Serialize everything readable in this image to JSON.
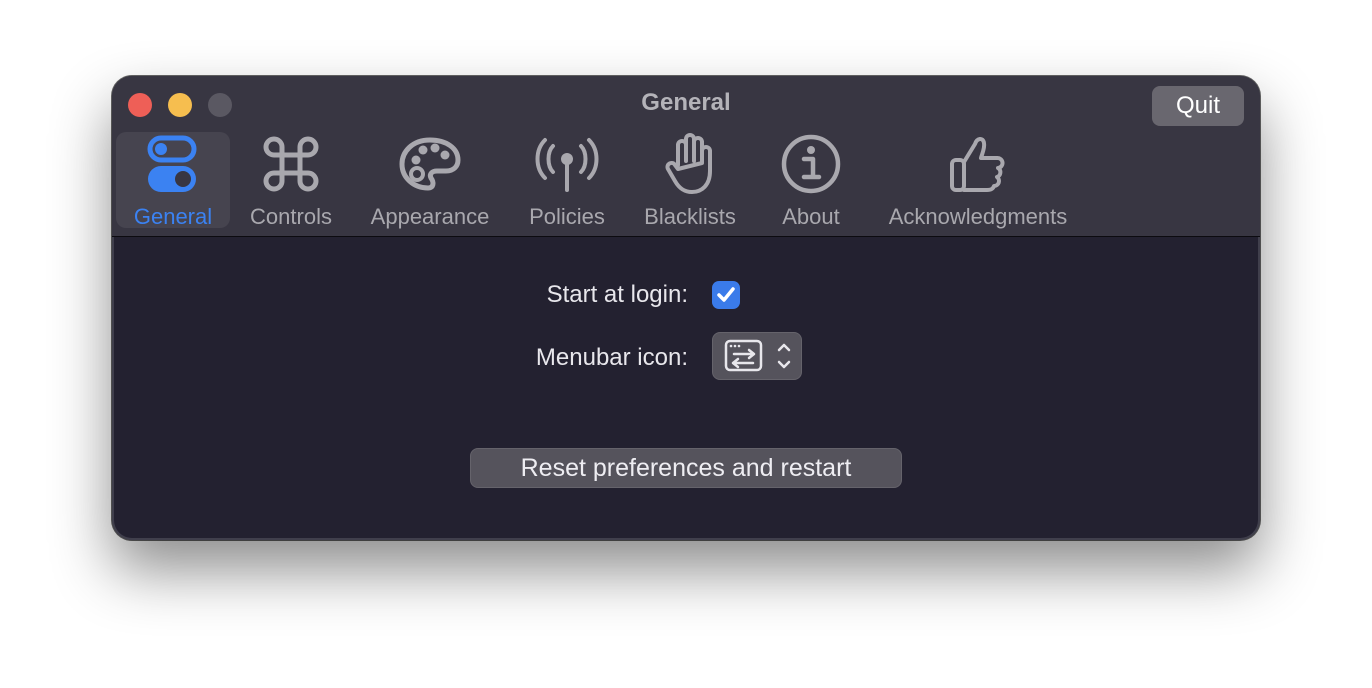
{
  "window": {
    "title": "General",
    "quit_label": "Quit"
  },
  "toolbar": {
    "items": [
      {
        "label": "General",
        "icon": "toggles-icon",
        "selected": true
      },
      {
        "label": "Controls",
        "icon": "command-icon",
        "selected": false
      },
      {
        "label": "Appearance",
        "icon": "palette-icon",
        "selected": false
      },
      {
        "label": "Policies",
        "icon": "antenna-icon",
        "selected": false
      },
      {
        "label": "Blacklists",
        "icon": "hand-icon",
        "selected": false
      },
      {
        "label": "About",
        "icon": "info-icon",
        "selected": false
      },
      {
        "label": "Acknowledgments",
        "icon": "thumbs-up-icon",
        "selected": false
      }
    ]
  },
  "general": {
    "start_at_login_label": "Start at login:",
    "start_at_login_checked": true,
    "menubar_icon_label": "Menubar icon:",
    "menubar_icon_selected": "switch-windows-icon",
    "reset_label": "Reset preferences and restart"
  },
  "colors": {
    "accent": "#3b82f2",
    "window_bg": "#232130",
    "titlebar_bg": "#383642"
  }
}
